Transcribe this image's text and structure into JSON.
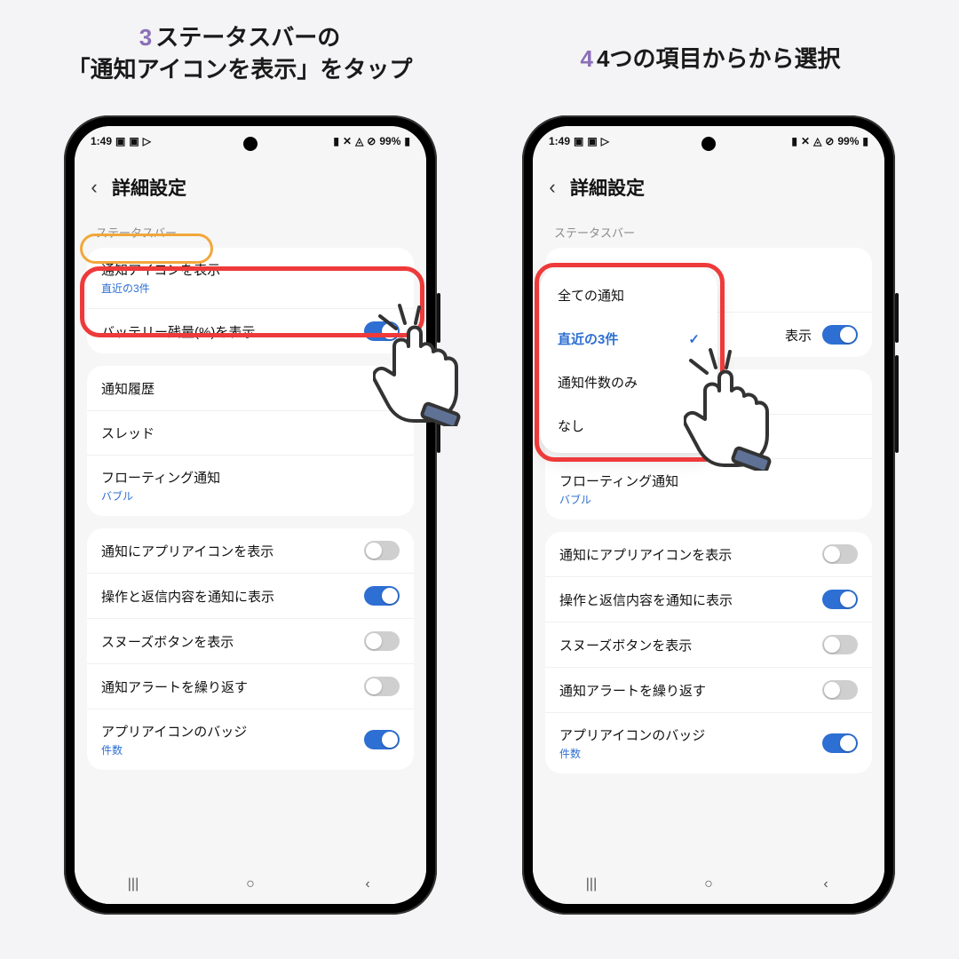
{
  "instructions": {
    "left": {
      "num": "3",
      "text1": "ステータスバーの",
      "text2": "「通知アイコンを表示」をタップ"
    },
    "right": {
      "num": "4",
      "text": "4つの項目からから選択"
    }
  },
  "statusbar": {
    "time": "1:49",
    "battery": "99%"
  },
  "header": {
    "title": "詳細設定"
  },
  "section_label": "ステータスバー",
  "rows": {
    "notif_icons": {
      "label": "通知アイコンを表示",
      "sub": "直近の3件"
    },
    "battery_pct": {
      "label": "バッテリー残量(%)を表示",
      "on": true
    },
    "notif_history": {
      "label": "通知履歴"
    },
    "thread": {
      "label": "スレッド"
    },
    "floating": {
      "label": "フローティング通知",
      "sub": "バブル"
    },
    "app_icon": {
      "label": "通知にアプリアイコンを表示",
      "on": false
    },
    "actions_reply": {
      "label": "操作と返信内容を通知に表示",
      "on": true
    },
    "snooze": {
      "label": "スヌーズボタンを表示",
      "on": false
    },
    "repeat_alert": {
      "label": "通知アラートを繰り返す",
      "on": false
    },
    "badge": {
      "label": "アプリアイコンのバッジ",
      "sub": "件数",
      "on": true
    }
  },
  "right_phone_visible": {
    "battery_row_suffix": "表示"
  },
  "popup": {
    "items": [
      {
        "label": "全ての通知",
        "selected": false
      },
      {
        "label": "直近の3件",
        "selected": true
      },
      {
        "label": "通知件数のみ",
        "selected": false
      },
      {
        "label": "なし",
        "selected": false
      }
    ]
  },
  "nav": {
    "recents": "|||",
    "home": "○",
    "back": "‹"
  },
  "colors": {
    "accent": "#2d6fd2",
    "highlight_red": "#ee3a3a",
    "highlight_orange": "#f2a73b",
    "step_number": "#8b6fb8"
  }
}
